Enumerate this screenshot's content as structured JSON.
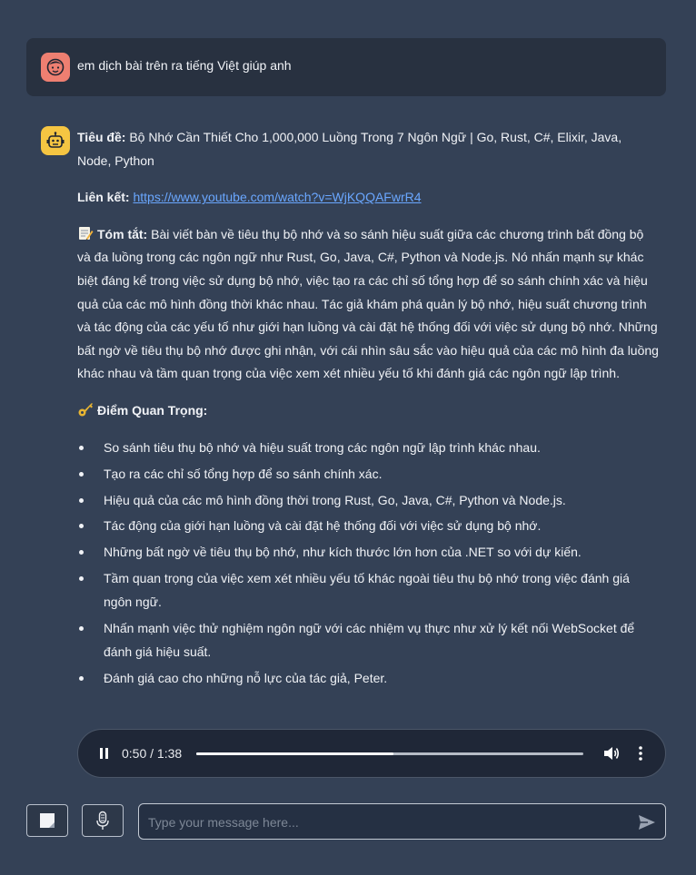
{
  "user_message": {
    "text": "em dịch bài trên ra tiếng Việt giúp anh",
    "avatar_icon": "face-icon"
  },
  "bot_message": {
    "avatar_icon": "robot-icon",
    "title_label": "Tiêu đề:",
    "title_text": "Bộ Nhớ Cần Thiết Cho 1,000,000 Luồng Trong 7 Ngôn Ngữ | Go, Rust, C#, Elixir, Java, Node, Python",
    "link_label": "Liên kết:",
    "link_url": "https://www.youtube.com/watch?v=WjKQQAFwrR4",
    "summary_label": "Tóm tắt:",
    "summary_text": "Bài viết bàn về tiêu thụ bộ nhớ và so sánh hiệu suất giữa các chương trình bất đồng bộ và đa luồng trong các ngôn ngữ như Rust, Go, Java, C#, Python và Node.js. Nó nhấn mạnh sự khác biệt đáng kể trong việc sử dụng bộ nhớ, việc tạo ra các chỉ số tổng hợp để so sánh chính xác và hiệu quả của các mô hình đồng thời khác nhau. Tác giả khám phá quản lý bộ nhớ, hiệu suất chương trình và tác động của các yếu tố như giới hạn luồng và cài đặt hệ thống đối với việc sử dụng bộ nhớ. Những bất ngờ về tiêu thụ bộ nhớ được ghi nhận, với cái nhìn sâu sắc vào hiệu quả của các mô hình đa luồng khác nhau và tầm quan trọng của việc xem xét nhiều yếu tố khi đánh giá các ngôn ngữ lập trình.",
    "key_points_label": "Điểm Quan Trọng:",
    "key_points": [
      "So sánh tiêu thụ bộ nhớ và hiệu suất trong các ngôn ngữ lập trình khác nhau.",
      "Tạo ra các chỉ số tổng hợp để so sánh chính xác.",
      "Hiệu quả của các mô hình đồng thời trong Rust, Go, Java, C#, Python và Node.js.",
      "Tác động của giới hạn luồng và cài đặt hệ thống đối với việc sử dụng bộ nhớ.",
      "Những bất ngờ về tiêu thụ bộ nhớ, như kích thước lớn hơn của .NET so với dự kiến.",
      "Tầm quan trọng của việc xem xét nhiều yếu tố khác ngoài tiêu thụ bộ nhớ trong việc đánh giá ngôn ngữ.",
      "Nhấn mạnh việc thử nghiệm ngôn ngữ với các nhiệm vụ thực như xử lý kết nối WebSocket để đánh giá hiệu suất.",
      "Đánh giá cao cho những nỗ lực của tác giả, Peter."
    ]
  },
  "audio_player": {
    "time": "0:50 / 1:38",
    "progress": 0.51,
    "icons": [
      "pause-icon",
      "volume-icon",
      "more-vertical-icon"
    ]
  },
  "composer": {
    "placeholder": "Type your message here...",
    "icons": [
      "note-icon",
      "microphone-icon",
      "send-icon"
    ]
  },
  "colors": {
    "background": "#344156",
    "user_bubble": "#283140",
    "link": "#6aa7ff",
    "user_avatar": "#ee7f71",
    "bot_avatar": "#f5c542"
  }
}
